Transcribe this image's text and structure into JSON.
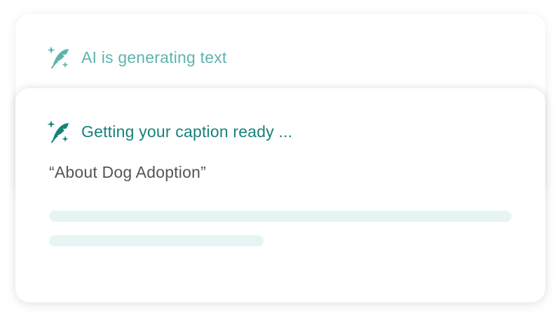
{
  "back_card": {
    "icon": "sparkle-quill-icon",
    "status": "AI is generating text",
    "color": "#5fb3ae"
  },
  "front_card": {
    "icon": "sparkle-quill-icon",
    "status": "Getting your caption ready ...",
    "topic": "“About Dog Adoption”",
    "color": "#17827a",
    "placeholder_color": "#e6f5f4"
  }
}
